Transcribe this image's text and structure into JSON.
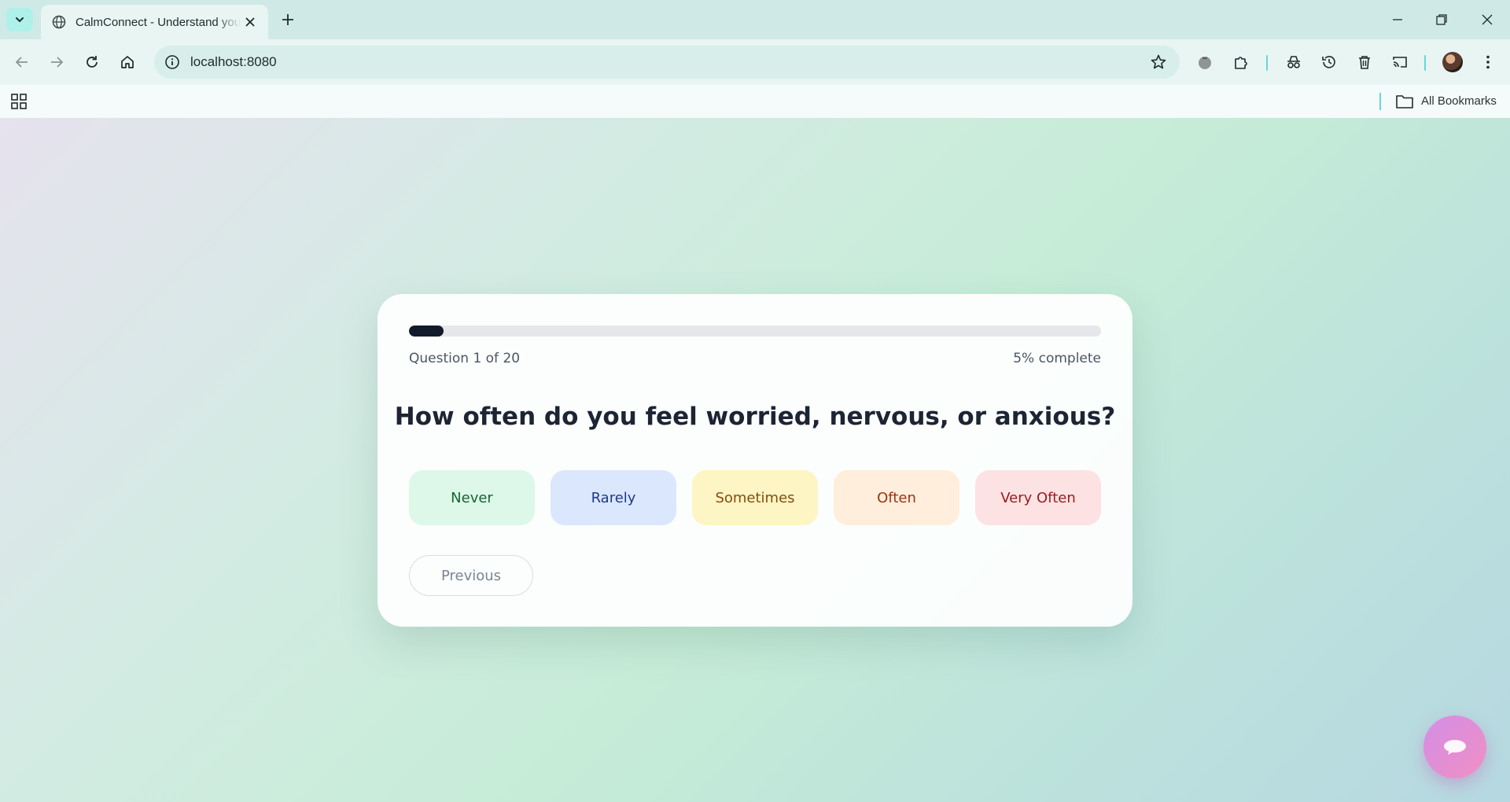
{
  "browser": {
    "tab_title": "CalmConnect - Understand your",
    "url": "localhost:8080",
    "bookmarks_label": "All Bookmarks"
  },
  "quiz": {
    "progress_fraction": 0.05,
    "counter_text": "Question 1 of 20",
    "percent_text": "5% complete",
    "question": "How often do you feel worried, nervous, or anxious?",
    "options": [
      {
        "label": "Never",
        "bg": "#ddf7e8",
        "fg": "#166534"
      },
      {
        "label": "Rarely",
        "bg": "#dbe7fd",
        "fg": "#1e3a8a"
      },
      {
        "label": "Sometimes",
        "bg": "#fdf5c4",
        "fg": "#854d0e"
      },
      {
        "label": "Often",
        "bg": "#feeedb",
        "fg": "#9a3412"
      },
      {
        "label": "Very Often",
        "bg": "#fde2e4",
        "fg": "#991b1b"
      }
    ],
    "previous_label": "Previous"
  },
  "icons": {
    "chat": "chat-bubble-icon"
  }
}
